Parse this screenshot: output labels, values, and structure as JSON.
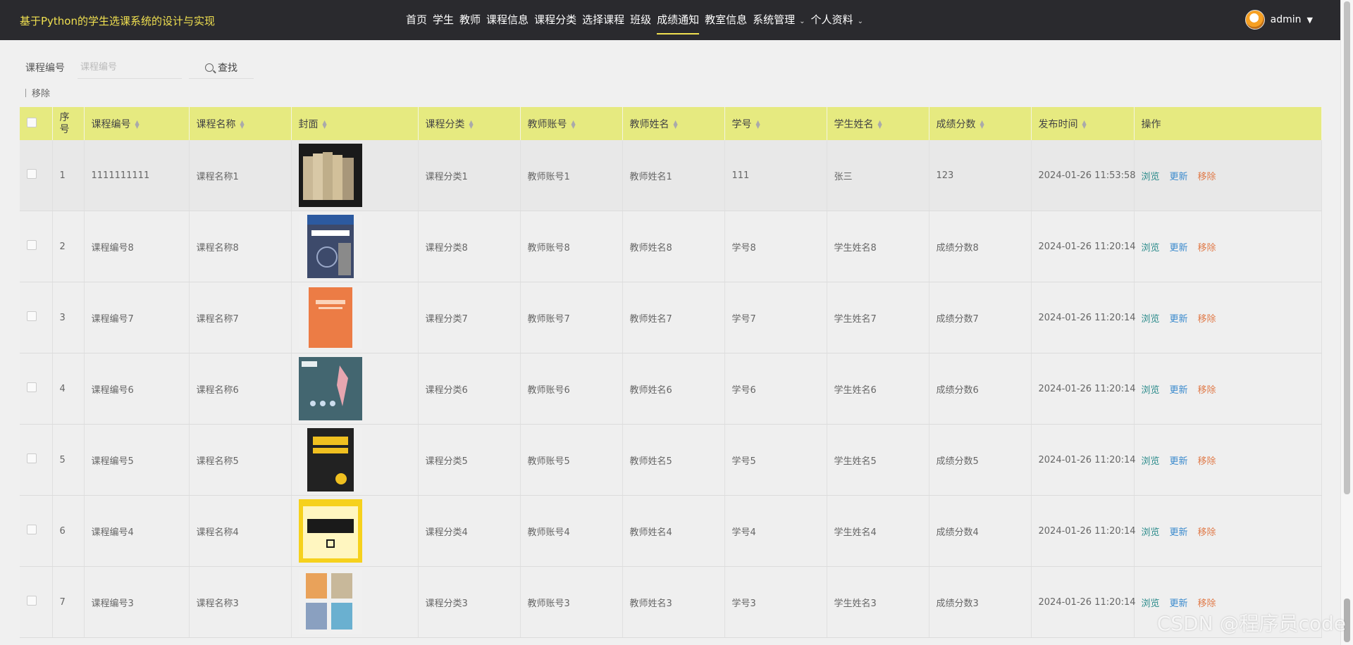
{
  "app": {
    "title": "基于Python的学生选课系统的设计与实现"
  },
  "nav": {
    "items": [
      {
        "label": "首页"
      },
      {
        "label": "学生"
      },
      {
        "label": "教师"
      },
      {
        "label": "课程信息"
      },
      {
        "label": "课程分类"
      },
      {
        "label": "选择课程"
      },
      {
        "label": "班级"
      },
      {
        "label": "成绩通知",
        "active": true
      },
      {
        "label": "教室信息"
      },
      {
        "label": "系统管理",
        "dropdown": true
      },
      {
        "label": "个人资料",
        "dropdown": true
      }
    ]
  },
  "user": {
    "name": "admin",
    "avatar_icon": "avatar-icon"
  },
  "search": {
    "label": "课程编号",
    "placeholder": "课程编号",
    "button_label": "查找"
  },
  "toolbar": {
    "remove_label": "移除"
  },
  "table": {
    "header_color": "#e6ea80",
    "columns": [
      "序号",
      "课程编号",
      "课程名称",
      "封面",
      "课程分类",
      "教师账号",
      "教师姓名",
      "学号",
      "学生姓名",
      "成绩分数",
      "发布时间",
      "操作"
    ],
    "actions": {
      "view": "浏览",
      "update": "更新",
      "remove": "移除"
    },
    "rows": [
      {
        "seq": "1",
        "course_no": "1111111111",
        "course_name": "课程名称1",
        "cover": "cover-books-stack",
        "category": "课程分类1",
        "teacher_account": "教师账号1",
        "teacher_name": "教师姓名1",
        "student_no": "111",
        "student_name": "张三",
        "score": "123",
        "time": "2024-01-26 11:53:58"
      },
      {
        "seq": "2",
        "course_no": "课程编号8",
        "course_name": "课程名称8",
        "cover": "cover-blue-book",
        "category": "课程分类8",
        "teacher_account": "教师账号8",
        "teacher_name": "教师姓名8",
        "student_no": "学号8",
        "student_name": "学生姓名8",
        "score": "成绩分数8",
        "time": "2024-01-26 11:20:14"
      },
      {
        "seq": "3",
        "course_no": "课程编号7",
        "course_name": "课程名称7",
        "cover": "cover-orange-book",
        "category": "课程分类7",
        "teacher_account": "教师账号7",
        "teacher_name": "教师姓名7",
        "student_no": "学号7",
        "student_name": "学生姓名7",
        "score": "成绩分数7",
        "time": "2024-01-26 11:20:14"
      },
      {
        "seq": "4",
        "course_no": "课程编号6",
        "course_name": "课程名称6",
        "cover": "cover-teal-illustration",
        "category": "课程分类6",
        "teacher_account": "教师账号6",
        "teacher_name": "教师姓名6",
        "student_no": "学号6",
        "student_name": "学生姓名6",
        "score": "成绩分数6",
        "time": "2024-01-26 11:20:14"
      },
      {
        "seq": "5",
        "course_no": "课程编号5",
        "course_name": "课程名称5",
        "cover": "cover-black-chemistry",
        "category": "课程分类5",
        "teacher_account": "教师账号5",
        "teacher_name": "教师姓名5",
        "student_no": "学号5",
        "student_name": "学生姓名5",
        "score": "成绩分数5",
        "time": "2024-01-26 11:20:14"
      },
      {
        "seq": "6",
        "course_no": "课程编号4",
        "course_name": "课程名称4",
        "cover": "cover-yellow-chinese",
        "category": "课程分类4",
        "teacher_account": "教师账号4",
        "teacher_name": "教师姓名4",
        "student_no": "学号4",
        "student_name": "学生姓名4",
        "score": "成绩分数4",
        "time": "2024-01-26 11:20:14"
      },
      {
        "seq": "7",
        "course_no": "课程编号3",
        "course_name": "课程名称3",
        "cover": "cover-multi-books",
        "category": "课程分类3",
        "teacher_account": "教师账号3",
        "teacher_name": "教师姓名3",
        "student_no": "学号3",
        "student_name": "学生姓名3",
        "score": "成绩分数3",
        "time": "2024-01-26 11:20:14"
      }
    ]
  },
  "watermark": "CSDN @程序员code"
}
